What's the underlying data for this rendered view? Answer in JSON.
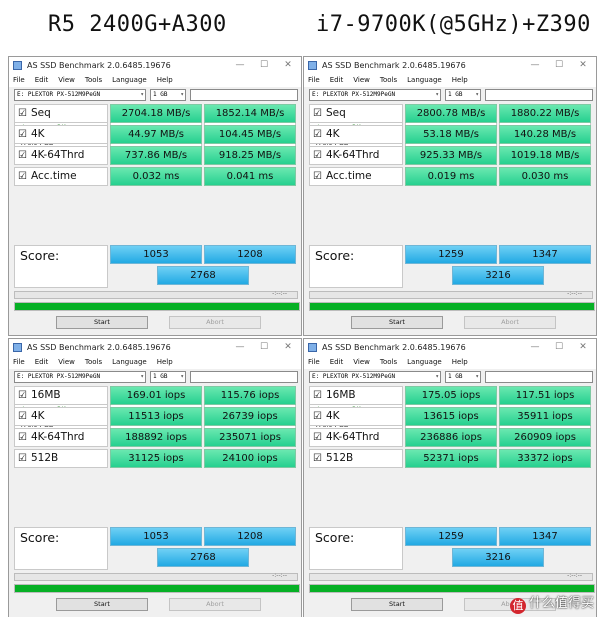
{
  "headings": {
    "left": "R5 2400G+A300",
    "right": "i7-9700K(@5GHz)+Z390"
  },
  "common": {
    "window_title": "AS SSD Benchmark 2.0.6485.19676",
    "menu": [
      "File",
      "Edit",
      "View",
      "Tools",
      "Language",
      "Help"
    ],
    "drive": "E: PLEXTOR PX-512M9PeGN",
    "size": "1 GB",
    "info": {
      "model": "PLEXTOR",
      "firmware": "1.07",
      "driver": "stornvme - OK",
      "alignment": "2048 K - OK",
      "capacity": "476.94 GB"
    },
    "read_header": "Read:",
    "write_header": "Write:",
    "score_label": "Score:",
    "time": "-:--:--",
    "start_label": "Start",
    "abort_label": "Abort",
    "progress_fill": 1.0,
    "check_mark": "☑",
    "minimize_glyph": "—",
    "maximize_glyph": "☐",
    "close_glyph": "✕",
    "dropdown_glyph": "▾"
  },
  "windows": [
    {
      "labels": [
        "Seq",
        "4K",
        "4K-64Thrd",
        "Acc.time"
      ],
      "read": [
        "2704.18 MB/s",
        "44.97 MB/s",
        "737.86 MB/s",
        "0.032 ms"
      ],
      "write": [
        "1852.14 MB/s",
        "104.45 MB/s",
        "918.25 MB/s",
        "0.041 ms"
      ],
      "score": {
        "read": "1053",
        "write": "1208",
        "total": "2768"
      }
    },
    {
      "labels": [
        "Seq",
        "4K",
        "4K-64Thrd",
        "Acc.time"
      ],
      "read": [
        "2800.78 MB/s",
        "53.18 MB/s",
        "925.33 MB/s",
        "0.019 ms"
      ],
      "write": [
        "1880.22 MB/s",
        "140.28 MB/s",
        "1019.18 MB/s",
        "0.030 ms"
      ],
      "score": {
        "read": "1259",
        "write": "1347",
        "total": "3216"
      }
    },
    {
      "labels": [
        "16MB",
        "4K",
        "4K-64Thrd",
        "512B"
      ],
      "read": [
        "169.01 iops",
        "11513 iops",
        "188892 iops",
        "31125 iops"
      ],
      "write": [
        "115.76 iops",
        "26739 iops",
        "235071 iops",
        "24100 iops"
      ],
      "score": {
        "read": "1053",
        "write": "1208",
        "total": "2768"
      }
    },
    {
      "labels": [
        "16MB",
        "4K",
        "4K-64Thrd",
        "512B"
      ],
      "read": [
        "175.05 iops",
        "13615 iops",
        "236886 iops",
        "52371 iops"
      ],
      "write": [
        "117.51 iops",
        "35911 iops",
        "260909 iops",
        "33372 iops"
      ],
      "score": {
        "read": "1259",
        "write": "1347",
        "total": "3216"
      }
    }
  ],
  "watermark": {
    "logo": "值",
    "text": "什么值得买"
  }
}
